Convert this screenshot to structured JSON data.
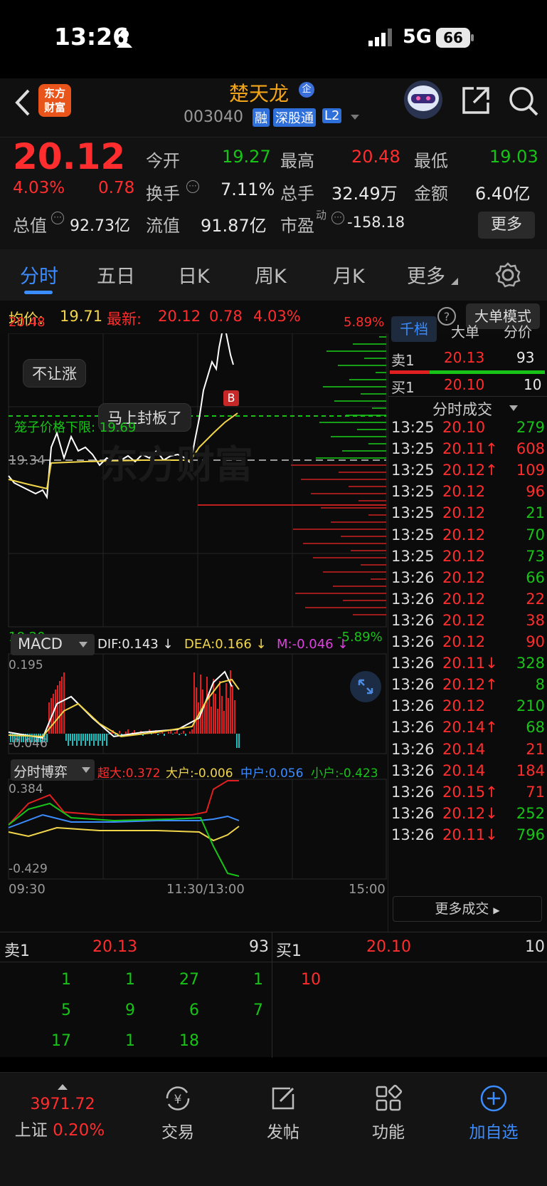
{
  "status": {
    "time": "13:26",
    "network": "5G",
    "battery": "66"
  },
  "header": {
    "brand_line1": "东方",
    "brand_line2": "财富",
    "stock_name": "楚天龙",
    "badge": "企",
    "stock_code": "003040",
    "tag_margin": "融",
    "tag_connect": "深股通",
    "tag_l2": "L2"
  },
  "quote": {
    "price": "20.12",
    "change_pct": "4.03%",
    "change_amt": "0.78",
    "open_label": "今开",
    "open": "19.27",
    "high_label": "最高",
    "high": "20.48",
    "low_label": "最低",
    "low": "19.03",
    "turnover_label": "换手",
    "turnover": "7.11%",
    "volume_label": "总手",
    "volume": "32.49万",
    "amount_label": "金额",
    "amount": "6.40亿",
    "mktcap_label": "总值",
    "mktcap": "92.73亿",
    "float_label": "流值",
    "float": "91.87亿",
    "pe_label": "市盈",
    "pe_sup": "动",
    "pe": "-158.18",
    "more_label": "更多"
  },
  "tabs": [
    "分时",
    "五日",
    "日K",
    "周K",
    "月K",
    "更多"
  ],
  "infobar": {
    "avg_label": "均价:",
    "avg": "19.71",
    "latest_label": "最新:",
    "latest": "20.12",
    "latest_chg": "0.78",
    "latest_pct": "4.03%",
    "mode_button": "大单模式"
  },
  "chart": {
    "y_high": "20.48",
    "y_pct_high": "5.89%",
    "y_mid": "19.34",
    "y_low": "18.20",
    "y_pct_low": "-5.89%",
    "note1": "不让涨",
    "note2": "马上封板了",
    "limit_label": "笼子价格下限: 19.69",
    "watermark": "东方财富",
    "buy_marker": "B",
    "x_start": "09:30",
    "x_mid": "11:30/13:00",
    "x_end": "15:00",
    "colors": {
      "price_line": "#ffffff",
      "avg_line": "#f1d54a",
      "up": "#e02020",
      "down": "#18c318"
    }
  },
  "macd": {
    "selector": "MACD",
    "dif": "DIF:0.143 ↓",
    "dea": "DEA:0.166 ↓",
    "m": "M:-0.046 ↓",
    "y_top": "0.195",
    "y_bottom": "-0.046"
  },
  "flow": {
    "selector": "分时博弈",
    "super": "超大:0.372",
    "large": "大户:-0.006",
    "mid": "中户:0.056",
    "small": "小户:-0.423",
    "y_top": "0.384",
    "y_bottom": "-0.429"
  },
  "right_panel": {
    "tabs": [
      "千档",
      "大单",
      "分价"
    ],
    "sell1_label": "卖1",
    "sell1_price": "20.13",
    "sell1_vol": "93",
    "buy1_label": "买1",
    "buy1_price": "20.10",
    "buy1_vol": "10",
    "ticks_title": "分时成交",
    "ticks": [
      {
        "t": "13:25",
        "p": "20.10",
        "v": "279",
        "pc": "red",
        "vc": "green"
      },
      {
        "t": "13:25",
        "p": "20.11↑",
        "v": "608",
        "pc": "red",
        "vc": "red"
      },
      {
        "t": "13:25",
        "p": "20.12↑",
        "v": "109",
        "pc": "red",
        "vc": "red"
      },
      {
        "t": "13:25",
        "p": "20.12",
        "v": "96",
        "pc": "red",
        "vc": "red"
      },
      {
        "t": "13:25",
        "p": "20.12",
        "v": "21",
        "pc": "red",
        "vc": "green"
      },
      {
        "t": "13:25",
        "p": "20.12",
        "v": "70",
        "pc": "red",
        "vc": "green"
      },
      {
        "t": "13:25",
        "p": "20.12",
        "v": "73",
        "pc": "red",
        "vc": "green"
      },
      {
        "t": "13:26",
        "p": "20.12",
        "v": "66",
        "pc": "red",
        "vc": "green"
      },
      {
        "t": "13:26",
        "p": "20.12",
        "v": "22",
        "pc": "red",
        "vc": "red"
      },
      {
        "t": "13:26",
        "p": "20.12",
        "v": "38",
        "pc": "red",
        "vc": "red"
      },
      {
        "t": "13:26",
        "p": "20.12",
        "v": "90",
        "pc": "red",
        "vc": "red"
      },
      {
        "t": "13:26",
        "p": "20.11↓",
        "v": "328",
        "pc": "red",
        "vc": "green"
      },
      {
        "t": "13:26",
        "p": "20.12↑",
        "v": "8",
        "pc": "red",
        "vc": "green"
      },
      {
        "t": "13:26",
        "p": "20.12",
        "v": "210",
        "pc": "red",
        "vc": "green"
      },
      {
        "t": "13:26",
        "p": "20.14↑",
        "v": "68",
        "pc": "red",
        "vc": "green"
      },
      {
        "t": "13:26",
        "p": "20.14",
        "v": "21",
        "pc": "red",
        "vc": "red"
      },
      {
        "t": "13:26",
        "p": "20.14",
        "v": "184",
        "pc": "red",
        "vc": "red"
      },
      {
        "t": "13:26",
        "p": "20.15↑",
        "v": "71",
        "pc": "red",
        "vc": "red"
      },
      {
        "t": "13:26",
        "p": "20.12↓",
        "v": "252",
        "pc": "red",
        "vc": "green"
      },
      {
        "t": "13:26",
        "p": "20.11↓",
        "v": "796",
        "pc": "red",
        "vc": "green"
      }
    ],
    "more_ticks": "更多成交"
  },
  "orderbook": {
    "sell_label": "卖1",
    "sell_price": "20.13",
    "sell_vol": "93",
    "buy_label": "买1",
    "buy_price": "20.10",
    "buy_vol": "10",
    "sell_rows": [
      [
        "1",
        "1",
        "27",
        "1"
      ],
      [
        "5",
        "9",
        "6",
        "7"
      ],
      [
        "17",
        "1",
        "18",
        ""
      ]
    ],
    "buy_rows": [
      [
        "10"
      ]
    ]
  },
  "bottom_nav": {
    "index_value": "3971.72",
    "index_name": "上证",
    "index_pct": "0.20%",
    "trade": "交易",
    "post": "发帖",
    "func": "功能",
    "watch": "加自选"
  }
}
